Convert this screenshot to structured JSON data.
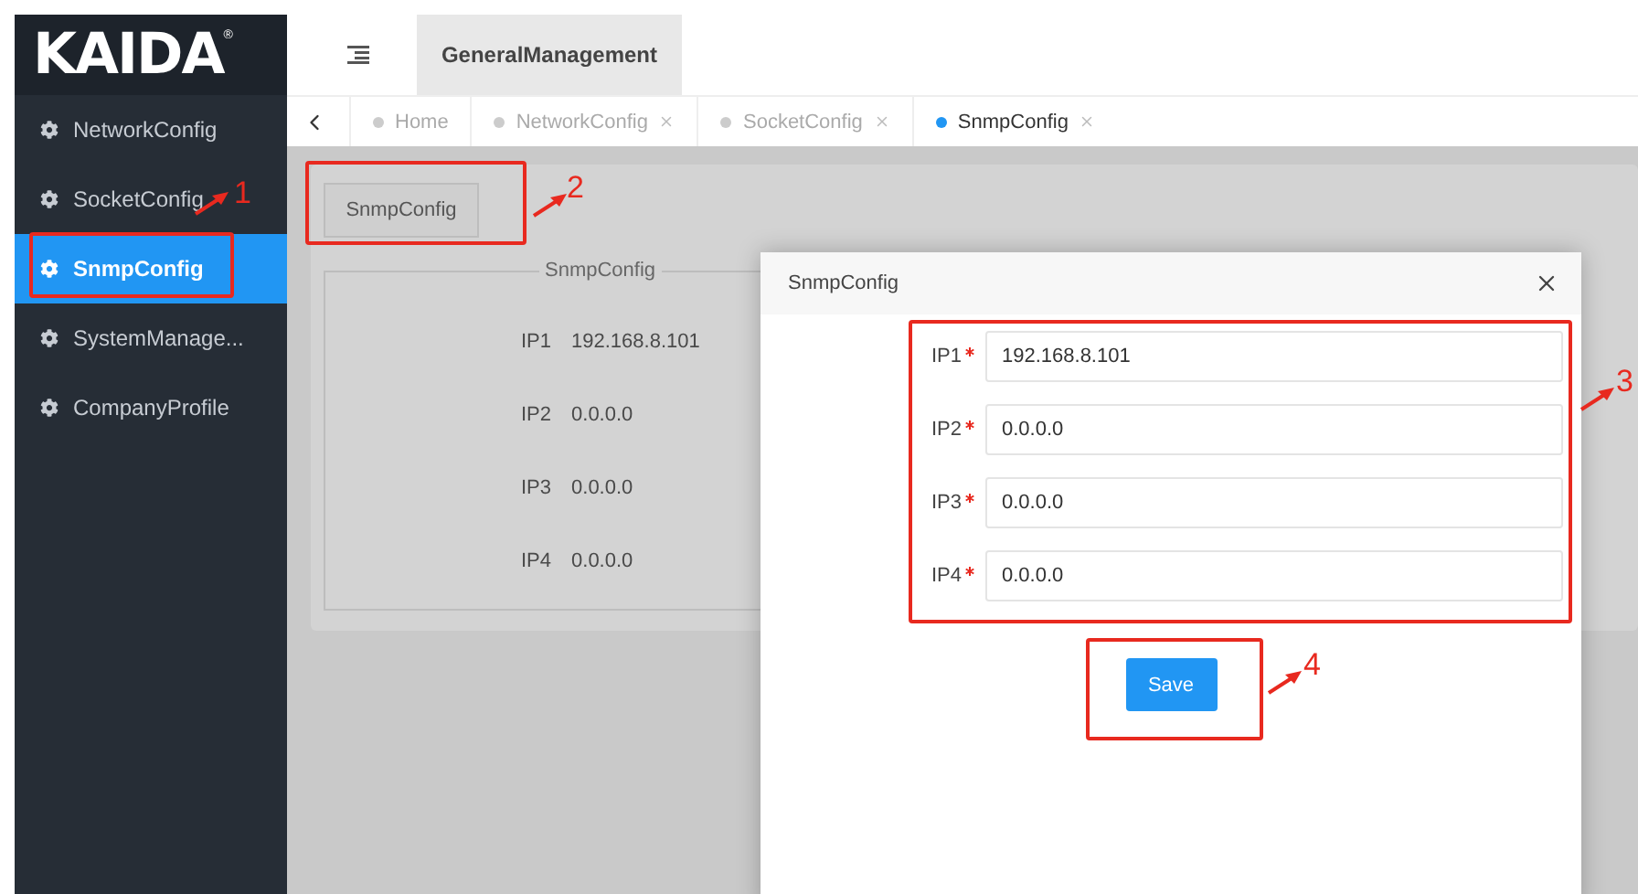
{
  "logo": {
    "text": "KAIDA",
    "mark": "®"
  },
  "header": {
    "title": "GeneralManagement"
  },
  "sidebar": {
    "items": [
      {
        "label": "NetworkConfig",
        "selected": false
      },
      {
        "label": "SocketConfig",
        "selected": false
      },
      {
        "label": "SnmpConfig",
        "selected": true
      },
      {
        "label": "SystemManage...",
        "selected": false
      },
      {
        "label": "CompanyProfile",
        "selected": false
      }
    ]
  },
  "tabs": [
    {
      "label": "Home",
      "selected": false,
      "closable": false
    },
    {
      "label": "NetworkConfig",
      "selected": false,
      "closable": true
    },
    {
      "label": "SocketConfig",
      "selected": false,
      "closable": true
    },
    {
      "label": "SnmpConfig",
      "selected": true,
      "closable": true
    }
  ],
  "page": {
    "button": "SnmpConfig",
    "legend": "SnmpConfig",
    "rows": [
      {
        "label": "IP1",
        "value": "192.168.8.101"
      },
      {
        "label": "IP2",
        "value": "0.0.0.0"
      },
      {
        "label": "IP3",
        "value": "0.0.0.0"
      },
      {
        "label": "IP4",
        "value": "0.0.0.0"
      }
    ]
  },
  "dialog": {
    "title": "SnmpConfig",
    "fields": [
      {
        "label": "IP1",
        "required": true,
        "value": "192.168.8.101"
      },
      {
        "label": "IP2",
        "required": true,
        "value": "0.0.0.0"
      },
      {
        "label": "IP3",
        "required": true,
        "value": "0.0.0.0"
      },
      {
        "label": "IP4",
        "required": true,
        "value": "0.0.0.0"
      }
    ],
    "save": "Save"
  },
  "annotations": [
    {
      "label": "1"
    },
    {
      "label": "2"
    },
    {
      "label": "3"
    },
    {
      "label": "4"
    }
  ]
}
